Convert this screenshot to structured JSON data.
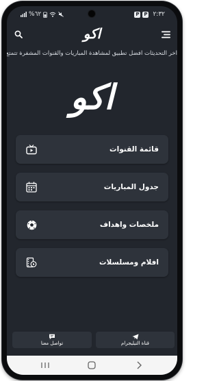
{
  "status_bar": {
    "time": "٢:٣٢",
    "battery": "%٦٢",
    "notification_badges": [
      "P",
      "P"
    ]
  },
  "header": {
    "logo": "اكو",
    "menu_icon": "hamburger-menu-icon",
    "search_icon": "search-icon"
  },
  "ticker": {
    "text": "اخر التحديثات    افضل تطبيق لمشاهدة المباريات والقنوات المشفرة تتمتع"
  },
  "hero": {
    "logo": "اكو"
  },
  "menu": {
    "items": [
      {
        "label": "قائمة القنوات",
        "icon": "tv-icon"
      },
      {
        "label": "جدول المباريات",
        "icon": "calendar-icon"
      },
      {
        "label": "ملخصات واهداف",
        "icon": "soccer-ball-icon"
      },
      {
        "label": "افلام ومسلسلات",
        "icon": "film-icon"
      }
    ]
  },
  "bottom_buttons": {
    "telegram": {
      "label": "قناة التيليجرام",
      "icon": "send-icon"
    },
    "contact": {
      "label": "تواصل معنا",
      "icon": "chat-icon"
    }
  },
  "nav_bar": {
    "recents_icon": "recents-icon",
    "home_icon": "home-icon",
    "back_icon": "back-icon"
  },
  "colors": {
    "background": "#22262d",
    "card": "#2e333b",
    "text": "#ffffff"
  }
}
